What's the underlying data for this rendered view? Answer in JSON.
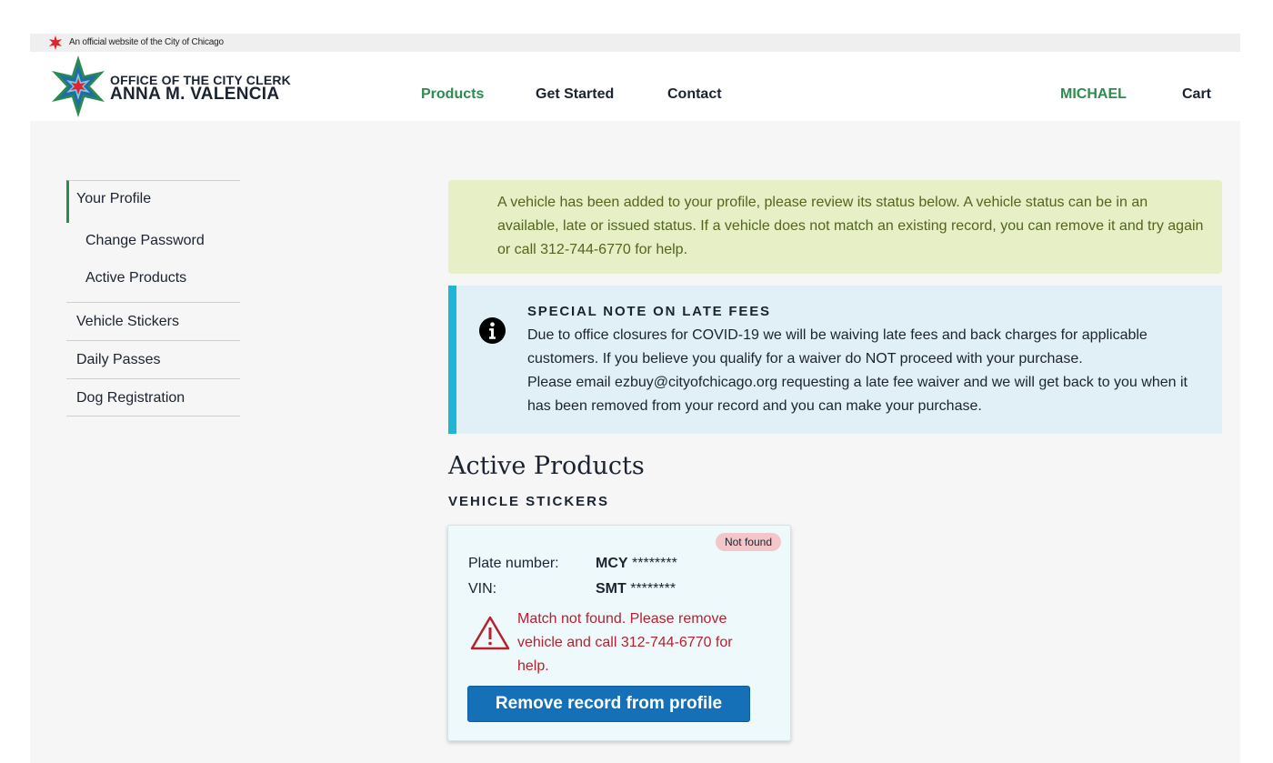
{
  "official": {
    "text": "An official website of the City of Chicago",
    "icon": "chicago-star-icon"
  },
  "logo": {
    "line1": "OFFICE OF THE CITY CLERK",
    "line2": "ANNA M. VALENCIA"
  },
  "nav": {
    "products": "Products",
    "get_started": "Get Started",
    "contact": "Contact",
    "user": "MICHAEL",
    "cart": "Cart"
  },
  "sidebar": {
    "profile": "Your Profile",
    "change_password": "Change Password",
    "active_products": "Active Products",
    "vehicle_stickers": "Vehicle Stickers",
    "daily_passes": "Daily Passes",
    "dog_registration": "Dog Registration"
  },
  "alerts": {
    "success": "A vehicle has been added to your profile, please review its status below. A vehicle status can be in an available, late or issued status. If a vehicle does not match an existing record, you can remove it and try again or call 312-744-6770 for help.",
    "info_title": "SPECIAL NOTE ON LATE FEES",
    "info_body_1": "Due to office closures for COVID-19 we will be waiving late fees and back charges for applicable customers. If you believe you qualify for a waiver do NOT proceed with your purchase.",
    "info_body_2": "Please email ezbuy@cityofchicago.org requesting a late fee waiver and we will get back to you when it has been removed from your record and you can make your purchase."
  },
  "main": {
    "title": "Active Products",
    "subtitle": "VEHICLE STICKERS"
  },
  "card": {
    "badge": "Not found",
    "plate_label": "Plate number:",
    "plate_prefix": "MCY",
    "plate_masked": " ********",
    "vin_label": "VIN:",
    "vin_prefix": "SMT",
    "vin_masked": " ********",
    "warning": "Match not found. Please remove vehicle and call 312-744-6770 for help.",
    "button": "Remove record from profile"
  },
  "colors": {
    "brand_green": "#2e8b4f",
    "info_accent": "#1fb6d6",
    "button_blue": "#1670b8",
    "error_red": "#b5212f",
    "success_bg": "#e6efc5"
  }
}
